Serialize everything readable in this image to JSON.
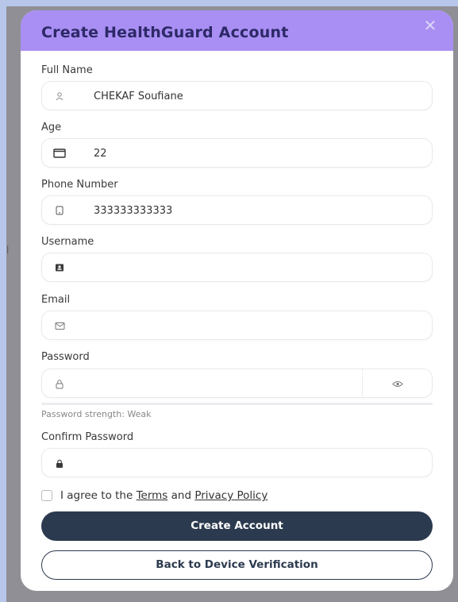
{
  "modal": {
    "title": "Create HealthGuard Account",
    "close_icon": "close-icon"
  },
  "fields": {
    "full_name": {
      "label": "Full Name",
      "value": "CHEKAF Soufiane",
      "icon": "user-icon"
    },
    "age": {
      "label": "Age",
      "value": "22",
      "icon": "calendar-icon"
    },
    "phone": {
      "label": "Phone Number",
      "value": "333333333333",
      "icon": "phone-icon"
    },
    "username": {
      "label": "Username",
      "value": "",
      "icon": "id-card-icon"
    },
    "email": {
      "label": "Email",
      "value": "",
      "icon": "envelope-icon"
    },
    "password": {
      "label": "Password",
      "value": "",
      "icon": "lock-icon",
      "toggle_icon": "eye-icon"
    },
    "confirm_password": {
      "label": "Confirm Password",
      "value": "",
      "icon": "lock-filled-icon"
    }
  },
  "password_strength": {
    "text": "Password strength: Weak",
    "level": 0
  },
  "agreement": {
    "prefix": "I agree to the ",
    "terms_link": "Terms",
    "middle": " and ",
    "privacy_link": "Privacy Policy"
  },
  "buttons": {
    "create_account": "Create Account",
    "back": "Back to Device Verification"
  },
  "colors": {
    "header": "#a98ff3",
    "title": "#2d2968",
    "primary": "#2c3a4f"
  }
}
